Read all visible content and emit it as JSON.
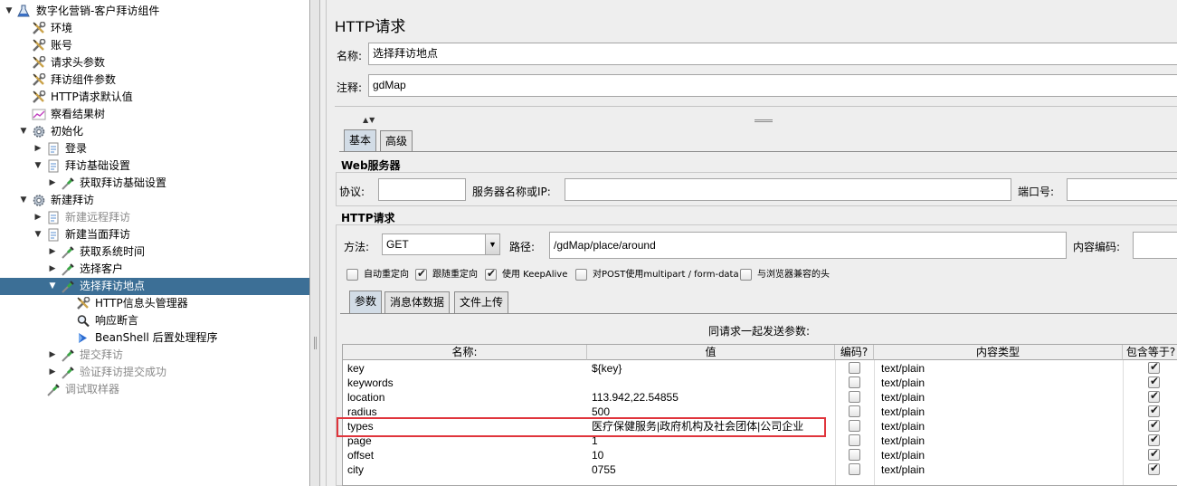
{
  "tree": [
    {
      "label": "数字化营销-客户拜访组件",
      "icon": "flask-icon",
      "toggle": "▼",
      "disabled": false,
      "selected": false
    },
    {
      "label": "环境",
      "icon": "wrench-icon",
      "toggle": "",
      "disabled": false,
      "selected": false
    },
    {
      "label": "账号",
      "icon": "wrench-icon",
      "toggle": "",
      "disabled": false,
      "selected": false
    },
    {
      "label": "请求头参数",
      "icon": "wrench-icon",
      "toggle": "",
      "disabled": false,
      "selected": false
    },
    {
      "label": "拜访组件参数",
      "icon": "wrench-icon",
      "toggle": "",
      "disabled": false,
      "selected": false
    },
    {
      "label": "HTTP请求默认值",
      "icon": "wrench-icon",
      "toggle": "",
      "disabled": false,
      "selected": false
    },
    {
      "label": "察看结果树",
      "icon": "graph-icon",
      "toggle": "",
      "disabled": false,
      "selected": false
    },
    {
      "label": "初始化",
      "icon": "gear-icon",
      "toggle": "▼",
      "disabled": false,
      "selected": false
    },
    {
      "label": "登录",
      "icon": "page-icon",
      "toggle": "▶",
      "disabled": false,
      "selected": false
    },
    {
      "label": "拜访基础设置",
      "icon": "page-icon",
      "toggle": "▼",
      "disabled": false,
      "selected": false
    },
    {
      "label": "获取拜访基础设置",
      "icon": "dropper-icon",
      "toggle": "▶",
      "disabled": false,
      "selected": false
    },
    {
      "label": "新建拜访",
      "icon": "gear-icon",
      "toggle": "▼",
      "disabled": false,
      "selected": false
    },
    {
      "label": "新建远程拜访",
      "icon": "page-icon",
      "toggle": "▶",
      "disabled": true,
      "selected": false
    },
    {
      "label": "新建当面拜访",
      "icon": "page-icon",
      "toggle": "▼",
      "disabled": false,
      "selected": false
    },
    {
      "label": "获取系统时间",
      "icon": "dropper-icon",
      "toggle": "▶",
      "disabled": false,
      "selected": false
    },
    {
      "label": "选择客户",
      "icon": "dropper-icon",
      "toggle": "▶",
      "disabled": false,
      "selected": false
    },
    {
      "label": "选择拜访地点",
      "icon": "dropper-icon",
      "toggle": "▼",
      "disabled": false,
      "selected": true
    },
    {
      "label": "HTTP信息头管理器",
      "icon": "wrench-icon",
      "toggle": "",
      "disabled": false,
      "selected": false
    },
    {
      "label": "响应断言",
      "icon": "magnifier-icon",
      "toggle": "",
      "disabled": false,
      "selected": false
    },
    {
      "label": "BeanShell 后置处理程序",
      "icon": "shell-icon",
      "toggle": "",
      "disabled": false,
      "selected": false
    },
    {
      "label": "提交拜访",
      "icon": "dropper-icon",
      "toggle": "▶",
      "disabled": true,
      "selected": false
    },
    {
      "label": "验证拜访提交成功",
      "icon": "dropper-icon",
      "toggle": "▶",
      "disabled": true,
      "selected": false
    },
    {
      "label": "调试取样器",
      "icon": "dropper-icon",
      "toggle": "",
      "disabled": true,
      "selected": false
    }
  ],
  "panel": {
    "title": "HTTP请求",
    "name_label": "名称:",
    "name_value": "选择拜访地点",
    "comment_label": "注释:",
    "comment_value": "gdMap",
    "tabs": [
      "基本",
      "高级"
    ],
    "web_server": {
      "title": "Web服务器",
      "protocol_label": "协议:",
      "protocol_value": "",
      "server_label": "服务器名称或IP:",
      "server_value": "",
      "port_label": "端口号:",
      "port_value": ""
    },
    "http_request": {
      "title": "HTTP请求",
      "method_label": "方法:",
      "method_value": "GET",
      "path_label": "路径:",
      "path_value": "/gdMap/place/around",
      "encoding_label": "内容编码:",
      "encoding_value": "",
      "options": [
        {
          "label": "自动重定向",
          "checked": false
        },
        {
          "label": "跟随重定向",
          "checked": true
        },
        {
          "label": "使用 KeepAlive",
          "checked": true
        },
        {
          "label": "对POST使用multipart / form-data",
          "checked": false
        },
        {
          "label": "与浏览器兼容的头",
          "checked": false
        }
      ]
    },
    "sub_tabs": [
      "参数",
      "消息体数据",
      "文件上传"
    ],
    "params_caption": "同请求一起发送参数:",
    "columns": [
      "名称:",
      "值",
      "编码?",
      "内容类型",
      "包含等于?"
    ],
    "params": [
      {
        "name": "key",
        "value": "${key}",
        "encode": false,
        "content_type": "text/plain",
        "include_equals": true
      },
      {
        "name": "keywords",
        "value": "",
        "encode": false,
        "content_type": "text/plain",
        "include_equals": true
      },
      {
        "name": "location",
        "value": "113.942,22.54855",
        "encode": false,
        "content_type": "text/plain",
        "include_equals": true
      },
      {
        "name": "radius",
        "value": "500",
        "encode": false,
        "content_type": "text/plain",
        "include_equals": true
      },
      {
        "name": "types",
        "value": "医疗保健服务|政府机构及社会团体|公司企业",
        "encode": false,
        "content_type": "text/plain",
        "include_equals": true
      },
      {
        "name": "page",
        "value": "1",
        "encode": false,
        "content_type": "text/plain",
        "include_equals": true
      },
      {
        "name": "offset",
        "value": "10",
        "encode": false,
        "content_type": "text/plain",
        "include_equals": true
      },
      {
        "name": "city",
        "value": "0755",
        "encode": false,
        "content_type": "text/plain",
        "include_equals": true
      }
    ],
    "highlight_color": "#e0353c"
  },
  "colors": {
    "selection": "#3c6f96",
    "panel_bg": "#eeeeee"
  }
}
